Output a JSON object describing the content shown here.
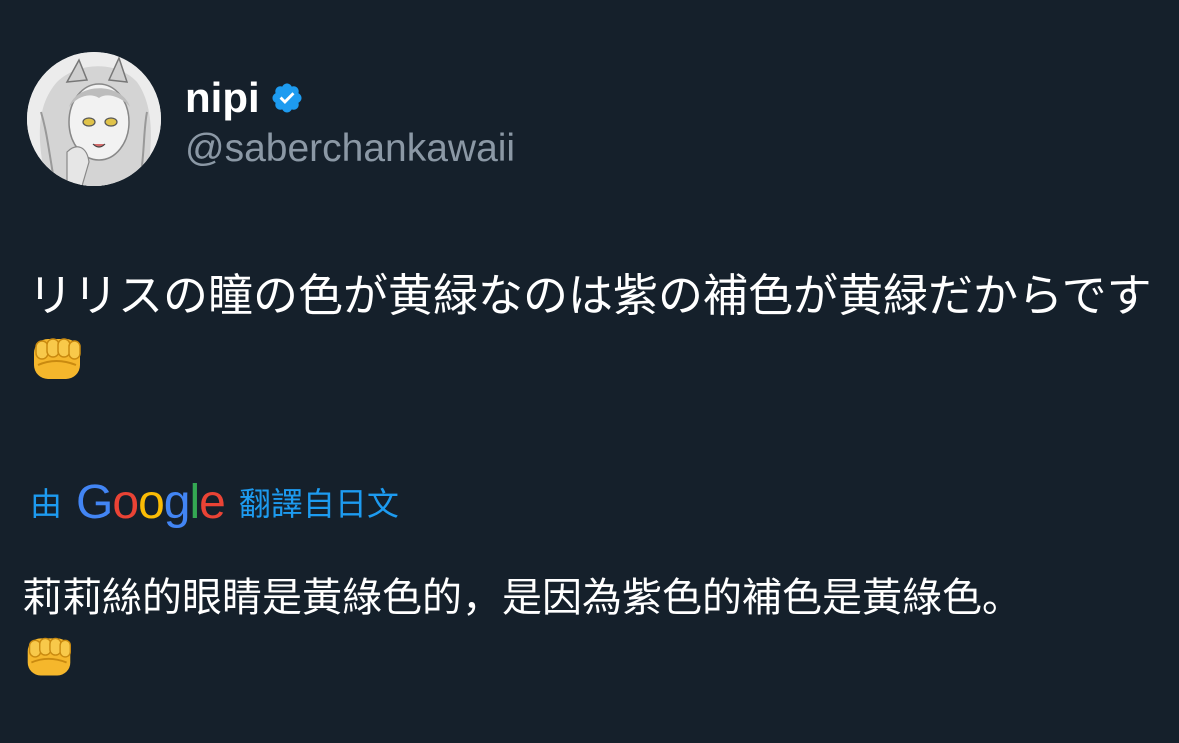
{
  "user": {
    "display_name": "nipi",
    "handle": "@saberchankawaii",
    "verified": true,
    "avatar_icon": "avatar-anime-girl-sketch"
  },
  "tweet": {
    "text": "リリスの瞳の色が黄緑なのは紫の補色が黄緑だからです",
    "emoji_icon": "oncoming-fist-emoji"
  },
  "translation": {
    "prefix": "由",
    "brand": [
      "G",
      "o",
      "o",
      "g",
      "l",
      "e"
    ],
    "suffix": "翻譯自日文",
    "text": "莉莉絲的眼睛是黃綠色的，是因為紫色的補色是黃綠色。"
  },
  "colors": {
    "background": "#15202b",
    "accent": "#1d9bf0",
    "secondary_text": "#8b98a5"
  }
}
